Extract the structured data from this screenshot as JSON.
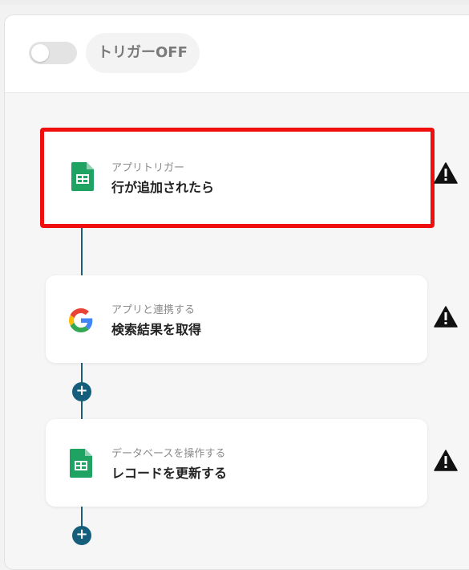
{
  "header": {
    "toggle_state": "off",
    "trigger_label": "トリガーOFF"
  },
  "steps": [
    {
      "subtitle": "アプリトリガー",
      "title": "行が追加されたら",
      "icon": "google-sheets-icon",
      "highlighted": true
    },
    {
      "subtitle": "アプリと連携する",
      "title": "検索結果を取得",
      "icon": "google-icon",
      "highlighted": false
    },
    {
      "subtitle": "データベースを操作する",
      "title": "レコードを更新する",
      "icon": "google-sheets-icon",
      "highlighted": false
    }
  ],
  "colors": {
    "highlight_border": "#f00f0f",
    "connector": "#1d5f7a",
    "add_button": "#155f7c",
    "sheets_green": "#1ea362"
  }
}
